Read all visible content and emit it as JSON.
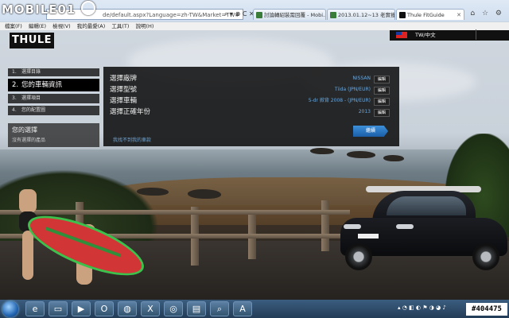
{
  "watermark": {
    "logo_text": "MOBILE01"
  },
  "browser": {
    "url": "de/default.aspx?Language=zh-TW&Market=TW#",
    "tabs": [
      {
        "label": "討論轉紹裝需回覆 - Mobi..."
      },
      {
        "label": "2013.01.12~13 老實撞爛..."
      },
      {
        "label": "Thule FitGuide",
        "active": true
      }
    ],
    "menu": [
      "檔案(F)",
      "編輯(E)",
      "檢視(V)",
      "我的最愛(A)",
      "工具(T)",
      "說明(H)"
    ]
  },
  "site": {
    "logo": "THULE",
    "language": "TW/中文"
  },
  "steps": [
    {
      "num": "1.",
      "label": "選擇目錄"
    },
    {
      "num": "2.",
      "label": "您的車輛資訊",
      "active": true
    },
    {
      "num": "3.",
      "label": "選擇項目"
    },
    {
      "num": "4.",
      "label": "您的配置圖"
    }
  ],
  "your_choice": {
    "heading": "您的選擇",
    "sub": "沒有選擇的產品"
  },
  "vehicle_rows": [
    {
      "label": "選擇廠牌",
      "value": "NISSAN",
      "edit": "編輯"
    },
    {
      "label": "選擇型號",
      "value": "Tiida (JPN/EUR)",
      "edit": "編輯"
    },
    {
      "label": "選擇車輛",
      "value": "5-dr 掀背 2008 - (JPN/EUR)",
      "edit": "編輯"
    },
    {
      "label": "選擇正確年份",
      "value": "2013",
      "edit": "編輯"
    }
  ],
  "panel": {
    "next_label": "繼續",
    "not_found": "我找不到我的車款"
  },
  "taskbar": {
    "clock": "#404475"
  }
}
